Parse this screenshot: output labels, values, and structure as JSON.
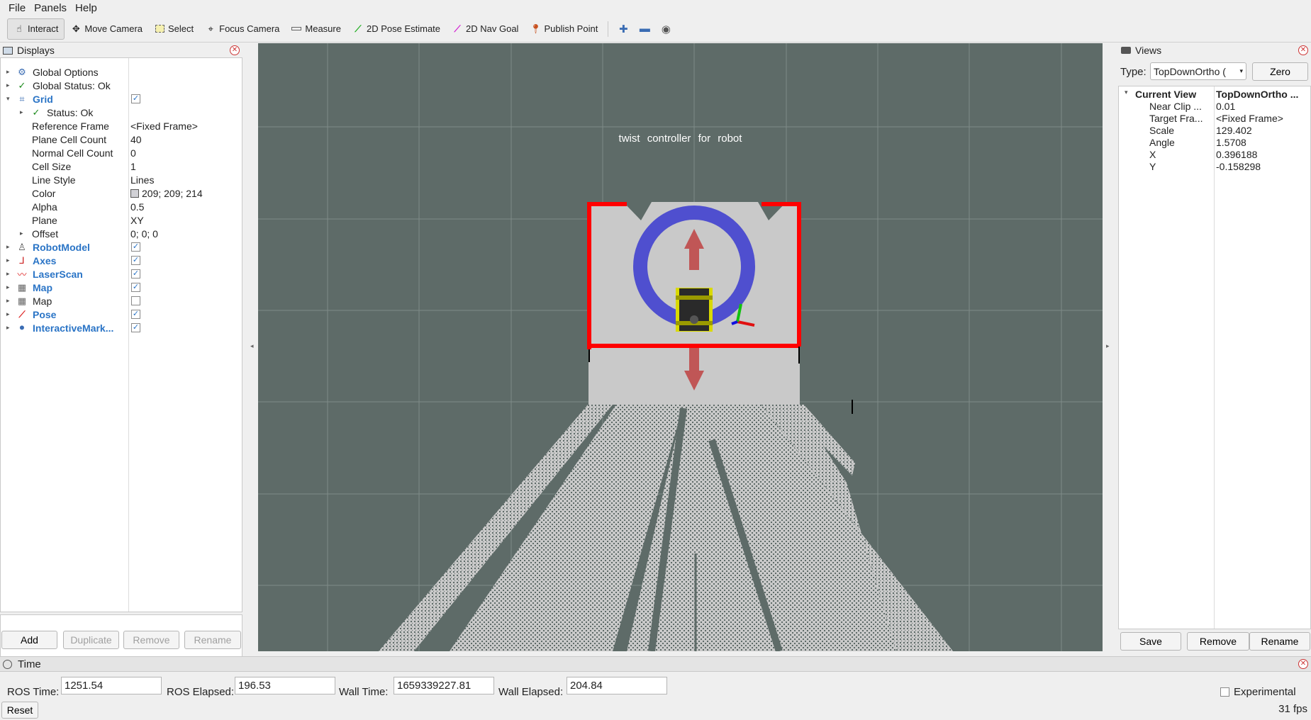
{
  "menubar": {
    "file": "File",
    "panels": "Panels",
    "help": "Help"
  },
  "toolbar": {
    "interact": "Interact",
    "move_camera": "Move Camera",
    "select": "Select",
    "focus_camera": "Focus Camera",
    "measure": "Measure",
    "pose_estimate": "2D Pose Estimate",
    "nav_goal": "2D Nav Goal",
    "publish_point": "Publish Point"
  },
  "displays": {
    "title": "Displays",
    "items": {
      "global_options": "Global Options",
      "global_status": "Global Status: Ok",
      "grid": "Grid",
      "grid_status": "Status: Ok",
      "reference_frame": {
        "label": "Reference Frame",
        "value": "<Fixed Frame>"
      },
      "plane_cell_count": {
        "label": "Plane Cell Count",
        "value": "40"
      },
      "normal_cell_count": {
        "label": "Normal Cell Count",
        "value": "0"
      },
      "cell_size": {
        "label": "Cell Size",
        "value": "1"
      },
      "line_style": {
        "label": "Line Style",
        "value": "Lines"
      },
      "color": {
        "label": "Color",
        "value": "209; 209; 214",
        "swatch": "#d1d1d6"
      },
      "alpha": {
        "label": "Alpha",
        "value": "0.5"
      },
      "plane": {
        "label": "Plane",
        "value": "XY"
      },
      "offset": {
        "label": "Offset",
        "value": "0; 0; 0"
      },
      "robot_model": "RobotModel",
      "axes": "Axes",
      "laser_scan": "LaserScan",
      "map1": "Map",
      "map2": "Map",
      "pose": "Pose",
      "interactive_markers": "InteractiveMark..."
    },
    "buttons": {
      "add": "Add",
      "duplicate": "Duplicate",
      "remove": "Remove",
      "rename": "Rename"
    }
  },
  "viewport": {
    "marker_text": "twist controller for robot"
  },
  "views": {
    "title": "Views",
    "type_label": "Type:",
    "type_value": "TopDownOrtho (",
    "zero": "Zero",
    "current_view": {
      "label": "Current View",
      "value": "TopDownOrtho ..."
    },
    "props": [
      {
        "label": "Near Clip ...",
        "value": "0.01"
      },
      {
        "label": "Target Fra...",
        "value": "<Fixed Frame>"
      },
      {
        "label": "Scale",
        "value": "129.402"
      },
      {
        "label": "Angle",
        "value": "1.5708"
      },
      {
        "label": "X",
        "value": "0.396188"
      },
      {
        "label": "Y",
        "value": "-0.158298"
      }
    ],
    "buttons": {
      "save": "Save",
      "remove": "Remove",
      "rename": "Rename"
    }
  },
  "time": {
    "title": "Time",
    "ros_time_label": "ROS Time:",
    "ros_time": "1251.54",
    "ros_elapsed_label": "ROS Elapsed:",
    "ros_elapsed": "196.53",
    "wall_time_label": "Wall Time:",
    "wall_time": "1659339227.81",
    "wall_elapsed_label": "Wall Elapsed:",
    "wall_elapsed": "204.84",
    "experimental": "Experimental",
    "reset": "Reset",
    "fps": "31 fps"
  },
  "colors": {
    "viewport_bg": "#5e6b68",
    "map_free": "#c9c9c9",
    "laser": "#ff0000",
    "ring": "#3030c8",
    "accent_blue": "#2a74c6"
  }
}
